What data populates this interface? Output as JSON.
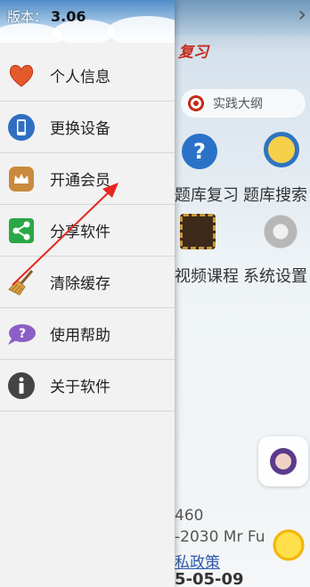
{
  "drawer": {
    "version_prefix": "版本：",
    "version_value": "3.06",
    "items": [
      {
        "label": "个人信息",
        "icon": "heart-icon"
      },
      {
        "label": "更换设备",
        "icon": "phone-icon"
      },
      {
        "label": "开通会员",
        "icon": "crown-icon"
      },
      {
        "label": "分享软件",
        "icon": "share-icon"
      },
      {
        "label": "清除缓存",
        "icon": "broom-icon"
      },
      {
        "label": "使用帮助",
        "icon": "help-bubble-icon"
      },
      {
        "label": "关于软件",
        "icon": "info-icon"
      }
    ]
  },
  "background": {
    "banner_title": "复习",
    "practice_button": "实践大纲",
    "grid": [
      "题库复习",
      "题库搜索",
      "视频课程",
      "系统设置"
    ],
    "footer_number": "460",
    "footer_copyright": "-2030 Mr Fu",
    "privacy_link": "私政策",
    "date": "5-05-09"
  },
  "colors": {
    "arrow": "#e8251f",
    "heart": "#e45a2a",
    "phone": "#2f6fc1",
    "crown_bg": "#c98a3c",
    "share": "#2aa845",
    "help": "#8b5fc7",
    "info": "#444444"
  }
}
